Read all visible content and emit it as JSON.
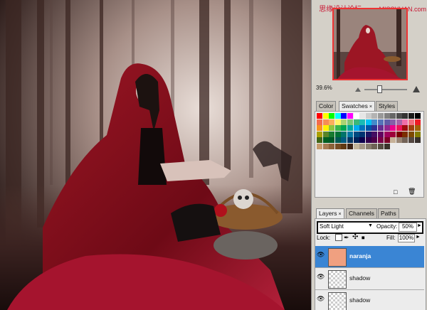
{
  "watermark": {
    "text": "思缘设计论坛",
    "url": "www.MISSYUAN.com"
  },
  "navigator": {
    "zoom": "39.6%",
    "zoom_slider_fraction": 0.35
  },
  "swatches_panel": {
    "tabs": [
      {
        "label": "Color"
      },
      {
        "label": "Swatches",
        "close": "×"
      },
      {
        "label": "Styles"
      }
    ],
    "swatch_colors": [
      "#ff0000",
      "#ffff00",
      "#00ff00",
      "#00ffff",
      "#0000ff",
      "#ff00ff",
      "#ffffff",
      "#e6e6e6",
      "#cccccc",
      "#b3b3b3",
      "#999999",
      "#808080",
      "#666666",
      "#4d4d4d",
      "#333333",
      "#1a1a1a",
      "#000000",
      "#f26c4f",
      "#f68e55",
      "#fbaf5c",
      "#fff467",
      "#acd372",
      "#7cc576",
      "#3bb878",
      "#1abbb4",
      "#00bff3",
      "#438ccb",
      "#5574b9",
      "#605ca8",
      "#855fa8",
      "#a763a8",
      "#f06ea9",
      "#f26d7d",
      "#ed1c24",
      "#f7941d",
      "#fff200",
      "#8dc63f",
      "#39b54a",
      "#00a651",
      "#00a99d",
      "#00aeef",
      "#0072bc",
      "#0054a6",
      "#2e3192",
      "#662d91",
      "#92278f",
      "#ec008c",
      "#ed145b",
      "#9e0b0f",
      "#a0410d",
      "#a3620a",
      "#aba000",
      "#598527",
      "#197b30",
      "#007236",
      "#00746b",
      "#0076a3",
      "#004a80",
      "#003471",
      "#1b1464",
      "#440e62",
      "#630460",
      "#9e005d",
      "#9e0039",
      "#790000",
      "#7b2e00",
      "#7d4900",
      "#827b00",
      "#406618",
      "#005e20",
      "#005826",
      "#005952",
      "#005b7f",
      "#003663",
      "#002157",
      "#0d004c",
      "#32004b",
      "#4b0049",
      "#7b0046",
      "#7a0026",
      "#c7b299",
      "#998675",
      "#736357",
      "#534741",
      "#37302d",
      "#c69c6d",
      "#a67c52",
      "#8c6239",
      "#754c24",
      "#603913",
      "#3c2415",
      "#c2b59b",
      "#a39787",
      "#887d6e",
      "#6e6356",
      "#544b40",
      "#3a332a"
    ]
  },
  "layers_panel": {
    "tabs": [
      {
        "label": "Layers",
        "close": "×"
      },
      {
        "label": "Channels"
      },
      {
        "label": "Paths"
      }
    ],
    "blend_mode": "Soft Light",
    "opacity_label": "Opacity:",
    "opacity_value": "50%",
    "lock_label": "Lock:",
    "fill_label": "Fill:",
    "fill_value": "100%",
    "layers": [
      {
        "name": "naranja",
        "selected": true
      },
      {
        "name": "shadow",
        "selected": false
      },
      {
        "name": "shadow",
        "selected": false
      }
    ]
  }
}
